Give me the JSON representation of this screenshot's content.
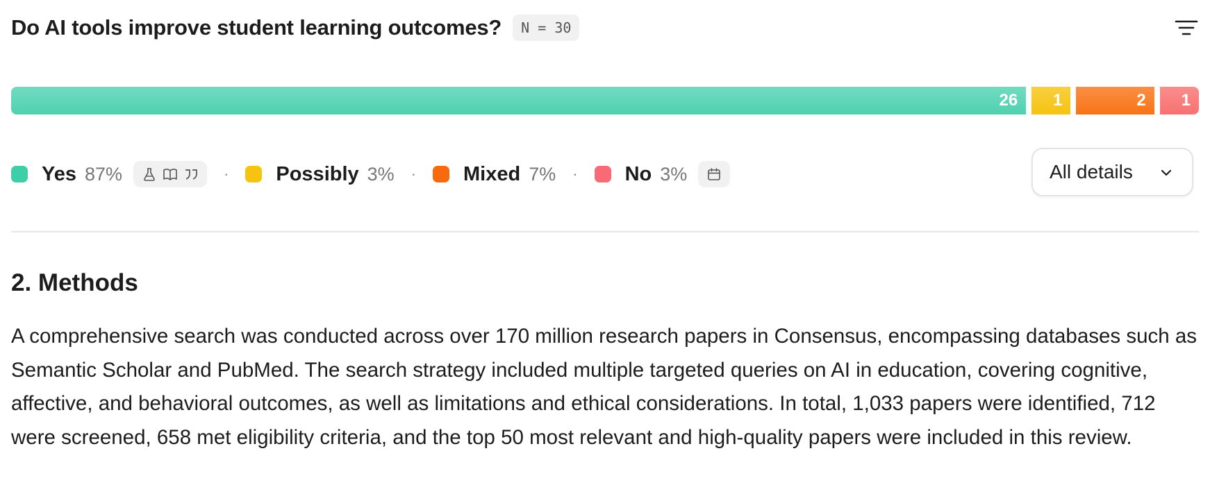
{
  "question": {
    "title": "Do AI tools improve student learning outcomes?",
    "n_label": "N = 30"
  },
  "consensus_bar": {
    "segments": [
      {
        "key": "yes",
        "count": 26,
        "label": "26",
        "color": "#4fd1b0"
      },
      {
        "key": "possibly",
        "count": 1,
        "label": "1",
        "color": "#f6c310"
      },
      {
        "key": "mixed",
        "count": 2,
        "label": "2",
        "color": "#f97316"
      },
      {
        "key": "no",
        "count": 1,
        "label": "1",
        "color": "#f87171"
      }
    ]
  },
  "legend": {
    "yes": {
      "label": "Yes",
      "pct": "87%",
      "color": "#3ecfa8"
    },
    "possibly": {
      "label": "Possibly",
      "pct": "3%",
      "color": "#f6c310"
    },
    "mixed": {
      "label": "Mixed",
      "pct": "7%",
      "color": "#f96a0e"
    },
    "no": {
      "label": "No",
      "pct": "3%",
      "color": "#f76a76"
    },
    "separator": "·"
  },
  "details_button": {
    "label": "All details"
  },
  "icons": {
    "filter": "filter-lines-icon",
    "study_type": "flask-icon",
    "journal": "book-open-icon",
    "citations": "quote-icon",
    "date": "calendar-icon",
    "chevron": "chevron-down-icon"
  },
  "methods": {
    "heading": "2. Methods",
    "body": "A comprehensive search was conducted across over 170 million research papers in Consensus, encompassing databases such as Semantic Scholar and PubMed. The search strategy included multiple targeted queries on AI in education, covering cognitive, affective, and behavioral outcomes, as well as limitations and ethical considerations. In total, 1,033 papers were identified, 712 were screened, 658 met eligibility criteria, and the top 50 most relevant and high-quality papers were included in this review."
  }
}
